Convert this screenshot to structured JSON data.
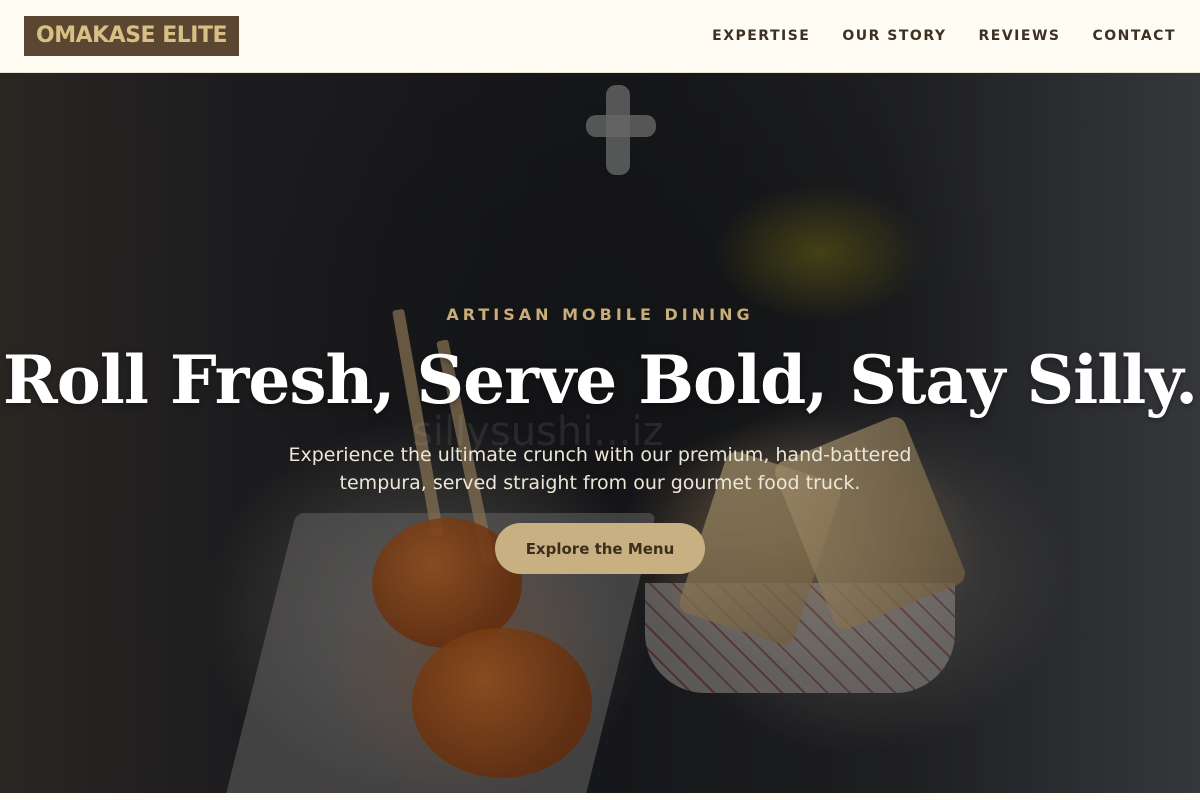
{
  "header": {
    "logo": "OMAKASE ELITE",
    "nav": [
      {
        "label": "EXPERTISE"
      },
      {
        "label": "OUR STORY"
      },
      {
        "label": "REVIEWS"
      },
      {
        "label": "CONTACT"
      }
    ]
  },
  "hero": {
    "eyebrow": "ARTISAN MOBILE DINING",
    "headline": "Roll Fresh, Serve Bold, Stay Silly.",
    "subtitle": "Experience the ultimate crunch with our premium, hand-battered tempura, served straight from our gourmet food truck.",
    "cta_label": "Explore the Menu",
    "watermark": "sillysushi...iz"
  },
  "colors": {
    "header_bg": "#fffdf3",
    "logo_bg": "#5a4631",
    "logo_text": "#d8bf86",
    "accent": "#c8ad7a",
    "cta_bg": "#c8b083"
  }
}
